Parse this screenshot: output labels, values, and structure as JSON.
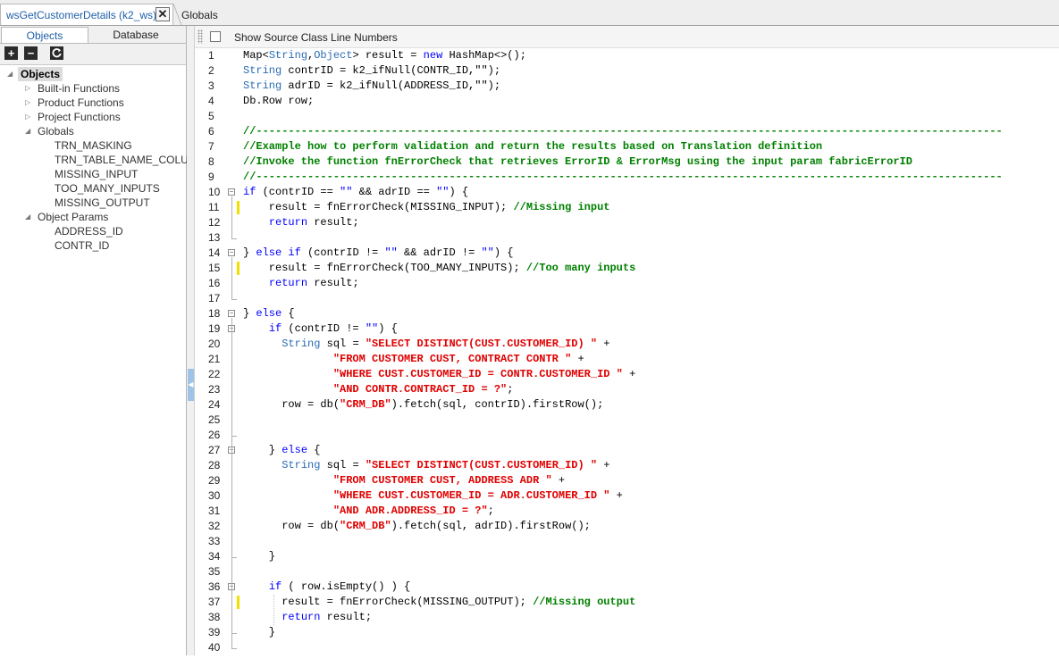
{
  "titlebar": {
    "tab_label": "wsGetCustomerDetails (k2_ws)",
    "close_symbol": "✕",
    "breadcrumb": "Globals"
  },
  "left_panel": {
    "tabs": [
      "Objects",
      "Database"
    ],
    "toolbar": {
      "add_icon": "plus-icon",
      "remove_icon": "minus-icon",
      "refresh_icon": "refresh-icon"
    },
    "tree": {
      "root": "Objects",
      "groups": [
        {
          "label": "Built-in Functions",
          "expanded": false,
          "children": []
        },
        {
          "label": "Product Functions",
          "expanded": false,
          "children": []
        },
        {
          "label": "Project Functions",
          "expanded": false,
          "children": []
        },
        {
          "label": "Globals",
          "expanded": true,
          "children": [
            "TRN_MASKING",
            "TRN_TABLE_NAME_COLU",
            "MISSING_INPUT",
            "TOO_MANY_INPUTS",
            "MISSING_OUTPUT"
          ]
        },
        {
          "label": "Object Params",
          "expanded": true,
          "children": [
            "ADDRESS_ID",
            "CONTR_ID"
          ]
        }
      ]
    }
  },
  "editor": {
    "show_line_numbers_label": "Show Source Class Line Numbers",
    "show_line_numbers_checked": false,
    "marked_lines": [
      11,
      15,
      37
    ],
    "fold_lines": [
      10,
      14,
      18,
      19,
      27,
      36
    ],
    "lines": [
      [
        [
          "Map<",
          ""
        ],
        [
          "String",
          "ty"
        ],
        [
          ",",
          ""
        ],
        [
          "Object",
          "ty"
        ],
        [
          "> result = ",
          ""
        ],
        [
          "new",
          "kw"
        ],
        [
          " HashMap<>();",
          ""
        ]
      ],
      [
        [
          "String",
          "ty"
        ],
        [
          " contrID = k2_ifNull(CONTR_ID,\"\");",
          ""
        ]
      ],
      [
        [
          "String",
          "ty"
        ],
        [
          " adrID = k2_ifNull(ADDRESS_ID,\"\");",
          ""
        ]
      ],
      [
        [
          "Db.Row row;",
          ""
        ]
      ],
      [],
      [
        [
          "//--------------------------------------------------------------------------------------------------------------------",
          "cm"
        ]
      ],
      [
        [
          "//Example how to perform validation and return the results based on Translation definition",
          "cm"
        ]
      ],
      [
        [
          "//Invoke the function fnErrorCheck that retrieves ErrorID & ErrorMsg using the input param fabricErrorID",
          "cm"
        ]
      ],
      [
        [
          "//--------------------------------------------------------------------------------------------------------------------",
          "cm"
        ]
      ],
      [
        [
          "if",
          "kw"
        ],
        [
          " (contrID == ",
          ""
        ],
        [
          "\"\"",
          "kw"
        ],
        [
          " && adrID == ",
          ""
        ],
        [
          "\"\"",
          "kw"
        ],
        [
          ") {",
          ""
        ]
      ],
      [
        [
          "    result = fnErrorCheck(MISSING_INPUT); ",
          ""
        ],
        [
          "//Missing input",
          "cm"
        ]
      ],
      [
        [
          "    ",
          ""
        ],
        [
          "return",
          "kw"
        ],
        [
          " result;",
          ""
        ]
      ],
      [],
      [
        [
          "} ",
          ""
        ],
        [
          "else if",
          "kw"
        ],
        [
          " (contrID != ",
          ""
        ],
        [
          "\"\"",
          "kw"
        ],
        [
          " && adrID != ",
          ""
        ],
        [
          "\"\"",
          "kw"
        ],
        [
          ") {",
          ""
        ]
      ],
      [
        [
          "    result = fnErrorCheck(TOO_MANY_INPUTS); ",
          ""
        ],
        [
          "//Too many inputs",
          "cm"
        ]
      ],
      [
        [
          "    ",
          ""
        ],
        [
          "return",
          "kw"
        ],
        [
          " result;",
          ""
        ]
      ],
      [],
      [
        [
          "} ",
          ""
        ],
        [
          "else",
          "kw"
        ],
        [
          " {",
          ""
        ]
      ],
      [
        [
          "    ",
          ""
        ],
        [
          "if",
          "kw"
        ],
        [
          " (contrID != ",
          ""
        ],
        [
          "\"\"",
          "kw"
        ],
        [
          ") {",
          ""
        ]
      ],
      [
        [
          "      ",
          ""
        ],
        [
          "String",
          "ty"
        ],
        [
          " sql = ",
          ""
        ],
        [
          "\"SELECT DISTINCT(CUST.CUSTOMER_ID) \"",
          "str"
        ],
        [
          " +",
          ""
        ]
      ],
      [
        [
          "              ",
          ""
        ],
        [
          "\"FROM CUSTOMER CUST, CONTRACT CONTR \"",
          "str"
        ],
        [
          " +",
          ""
        ]
      ],
      [
        [
          "              ",
          ""
        ],
        [
          "\"WHERE CUST.CUSTOMER_ID = CONTR.CUSTOMER_ID \"",
          "str"
        ],
        [
          " +",
          ""
        ]
      ],
      [
        [
          "              ",
          ""
        ],
        [
          "\"AND CONTR.CONTRACT_ID = ?\"",
          "str"
        ],
        [
          ";",
          ""
        ]
      ],
      [
        [
          "      row = db(",
          ""
        ],
        [
          "\"CRM_DB\"",
          "str"
        ],
        [
          ").fetch(sql, contrID).firstRow();",
          ""
        ]
      ],
      [],
      [],
      [
        [
          "    } ",
          ""
        ],
        [
          "else",
          "kw"
        ],
        [
          " {",
          ""
        ]
      ],
      [
        [
          "      ",
          ""
        ],
        [
          "String",
          "ty"
        ],
        [
          " sql = ",
          ""
        ],
        [
          "\"SELECT DISTINCT(CUST.CUSTOMER_ID) \"",
          "str"
        ],
        [
          " +",
          ""
        ]
      ],
      [
        [
          "              ",
          ""
        ],
        [
          "\"FROM CUSTOMER CUST, ADDRESS ADR \"",
          "str"
        ],
        [
          " +",
          ""
        ]
      ],
      [
        [
          "              ",
          ""
        ],
        [
          "\"WHERE CUST.CUSTOMER_ID = ADR.CUSTOMER_ID \"",
          "str"
        ],
        [
          " +",
          ""
        ]
      ],
      [
        [
          "              ",
          ""
        ],
        [
          "\"AND ADR.ADDRESS_ID = ?\"",
          "str"
        ],
        [
          ";",
          ""
        ]
      ],
      [
        [
          "      row = db(",
          ""
        ],
        [
          "\"CRM_DB\"",
          "str"
        ],
        [
          ").fetch(sql, adrID).firstRow();",
          ""
        ]
      ],
      [],
      [
        [
          "    }",
          ""
        ]
      ],
      [],
      [
        [
          "    ",
          ""
        ],
        [
          "if",
          "kw"
        ],
        [
          " ( row.isEmpty() ) {",
          ""
        ]
      ],
      [
        [
          "      result = fnErrorCheck(MISSING_OUTPUT); ",
          ""
        ],
        [
          "//Missing output",
          "cm"
        ]
      ],
      [
        [
          "      ",
          ""
        ],
        [
          "return",
          "kw"
        ],
        [
          " result;",
          ""
        ]
      ],
      [
        [
          "    }",
          ""
        ]
      ],
      []
    ]
  }
}
